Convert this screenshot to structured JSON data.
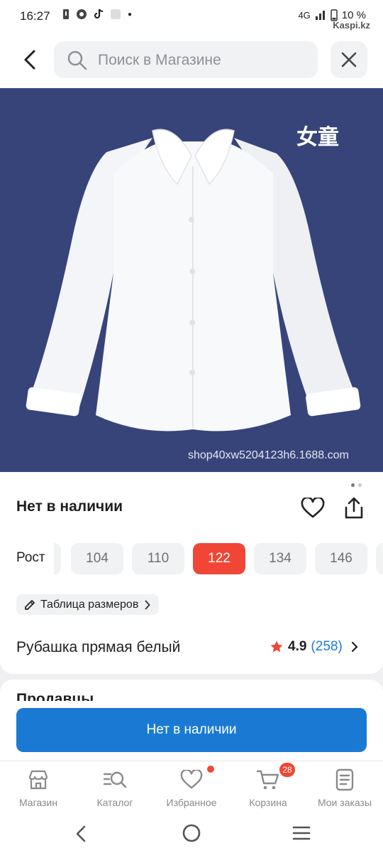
{
  "status_bar": {
    "time": "16:27",
    "network": "4G",
    "battery": "10 %",
    "watermark": "Kaspi.kz"
  },
  "header": {
    "search_placeholder": "Поиск в Магазине",
    "icons": [
      "back-arrow-icon",
      "search-icon",
      "close-icon"
    ]
  },
  "product_image": {
    "overlay_text": "女童",
    "source_url": "shop40xw5204123h6.1688.com",
    "colors": {
      "background": "#36447a"
    }
  },
  "product": {
    "availability": "Нет в наличии",
    "size_label": "Рост",
    "sizes": [
      "104",
      "110",
      "122",
      "134",
      "146"
    ],
    "selected_size": "122",
    "size_table_label": "Таблица размеров",
    "name": "Рубашка прямая белый",
    "rating": "4.9",
    "reviews": "(258)"
  },
  "sellers": {
    "heading": "Продавцы"
  },
  "cta": {
    "label": "Нет в наличии"
  },
  "bottom_nav": {
    "items": [
      {
        "label": "Магазин",
        "icon": "store-icon"
      },
      {
        "label": "Каталог",
        "icon": "catalog-search-icon"
      },
      {
        "label": "Избранное",
        "icon": "heart-icon"
      },
      {
        "label": "Корзина",
        "icon": "cart-icon",
        "badge": "28"
      },
      {
        "label": "Мои заказы",
        "icon": "orders-icon"
      }
    ]
  },
  "colors": {
    "accent_red": "#f14635",
    "primary_blue": "#1a7ad3",
    "link_blue": "#1d7ad6"
  }
}
